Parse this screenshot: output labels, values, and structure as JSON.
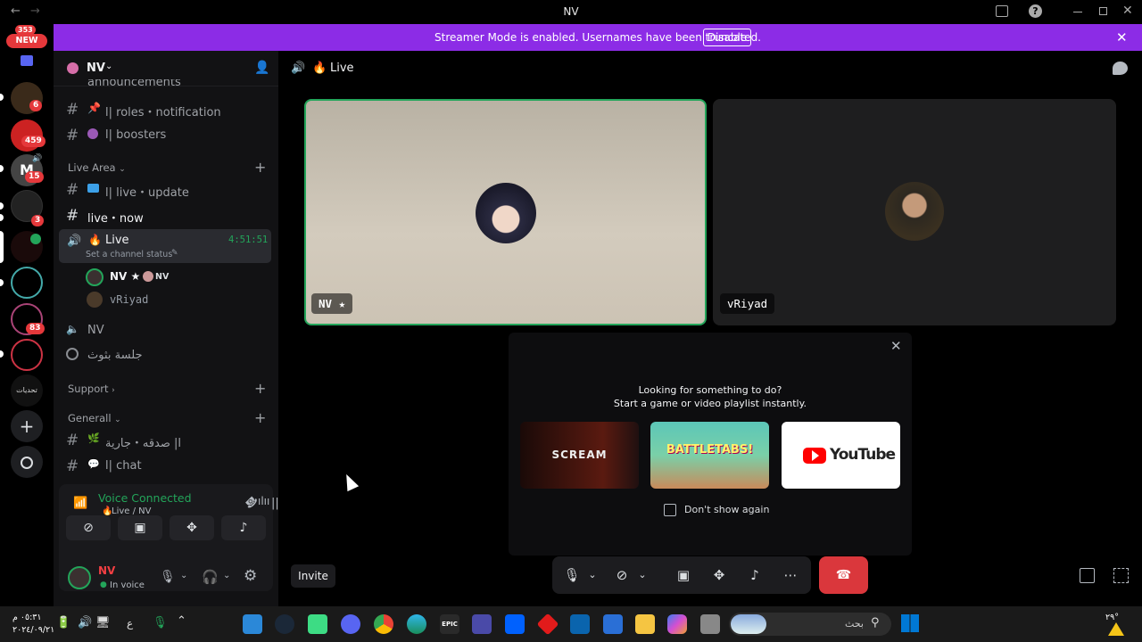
{
  "window": {
    "title": "NV",
    "back": "←",
    "forward": "→"
  },
  "rail": {
    "new_badge": "NEW",
    "new_count": "353",
    "servers": [
      {
        "badge": "6"
      },
      {
        "badge": "459"
      },
      {
        "badge": "15"
      },
      {
        "badge": "3"
      },
      {
        "badge": ""
      },
      {
        "badge": ""
      },
      {
        "badge": "83"
      },
      {
        "badge": ""
      },
      {
        "label": "تحديات"
      }
    ]
  },
  "banner": {
    "message": "Streamer Mode is enabled. Usernames have been truncated.",
    "disable_label": "Disable"
  },
  "server": {
    "name": "NV"
  },
  "channels": {
    "top_partial": "announcements",
    "items": [
      {
        "label": "ا| roles・notification"
      },
      {
        "label": "ا| boosters"
      }
    ],
    "cat_live": "Live Area",
    "live_items": [
      {
        "label": "ا| live・update"
      },
      {
        "label": "live・now"
      }
    ],
    "voice_live": {
      "label": "Live",
      "timer": "4:51:51",
      "status": "Set a channel status"
    },
    "members": [
      {
        "name": "NV ★",
        "extra": "NV"
      },
      {
        "name": "vRiyad"
      }
    ],
    "voice_nv": "NV",
    "stage": "جلسة بثوث",
    "cat_support": "Support",
    "cat_general": "Generall",
    "general_items": [
      {
        "label": "ا| صدقه・جارية"
      },
      {
        "label": "ا| chat"
      }
    ]
  },
  "voice_panel": {
    "status": "Voice Connected",
    "location": "Live / NV"
  },
  "user": {
    "name": "NV",
    "status": "In voice"
  },
  "main": {
    "header_title": "Live",
    "tiles": [
      {
        "name": "NV ★"
      },
      {
        "name": "vRiyad"
      }
    ],
    "popup": {
      "title": "Looking for something to do?",
      "subtitle": "Start a game or video playlist instantly.",
      "cards": [
        {
          "label": "SCREAM"
        },
        {
          "label": "BATTLETABS!"
        },
        {
          "label": "YouTube"
        }
      ],
      "dont_show": "Don't show again"
    },
    "invite_label": "Invite"
  },
  "taskbar": {
    "clock_time": "٠٥:٣١ م",
    "clock_date": "٢٠٢٤/٠٩/٢١",
    "lang": "ع",
    "search_placeholder": "بحث",
    "weather": "٢٩°"
  },
  "colors": {
    "banner": "#8c2ce6",
    "voice_connected": "#23a55a",
    "end_call": "#da373c",
    "badge": "#e5383b"
  }
}
